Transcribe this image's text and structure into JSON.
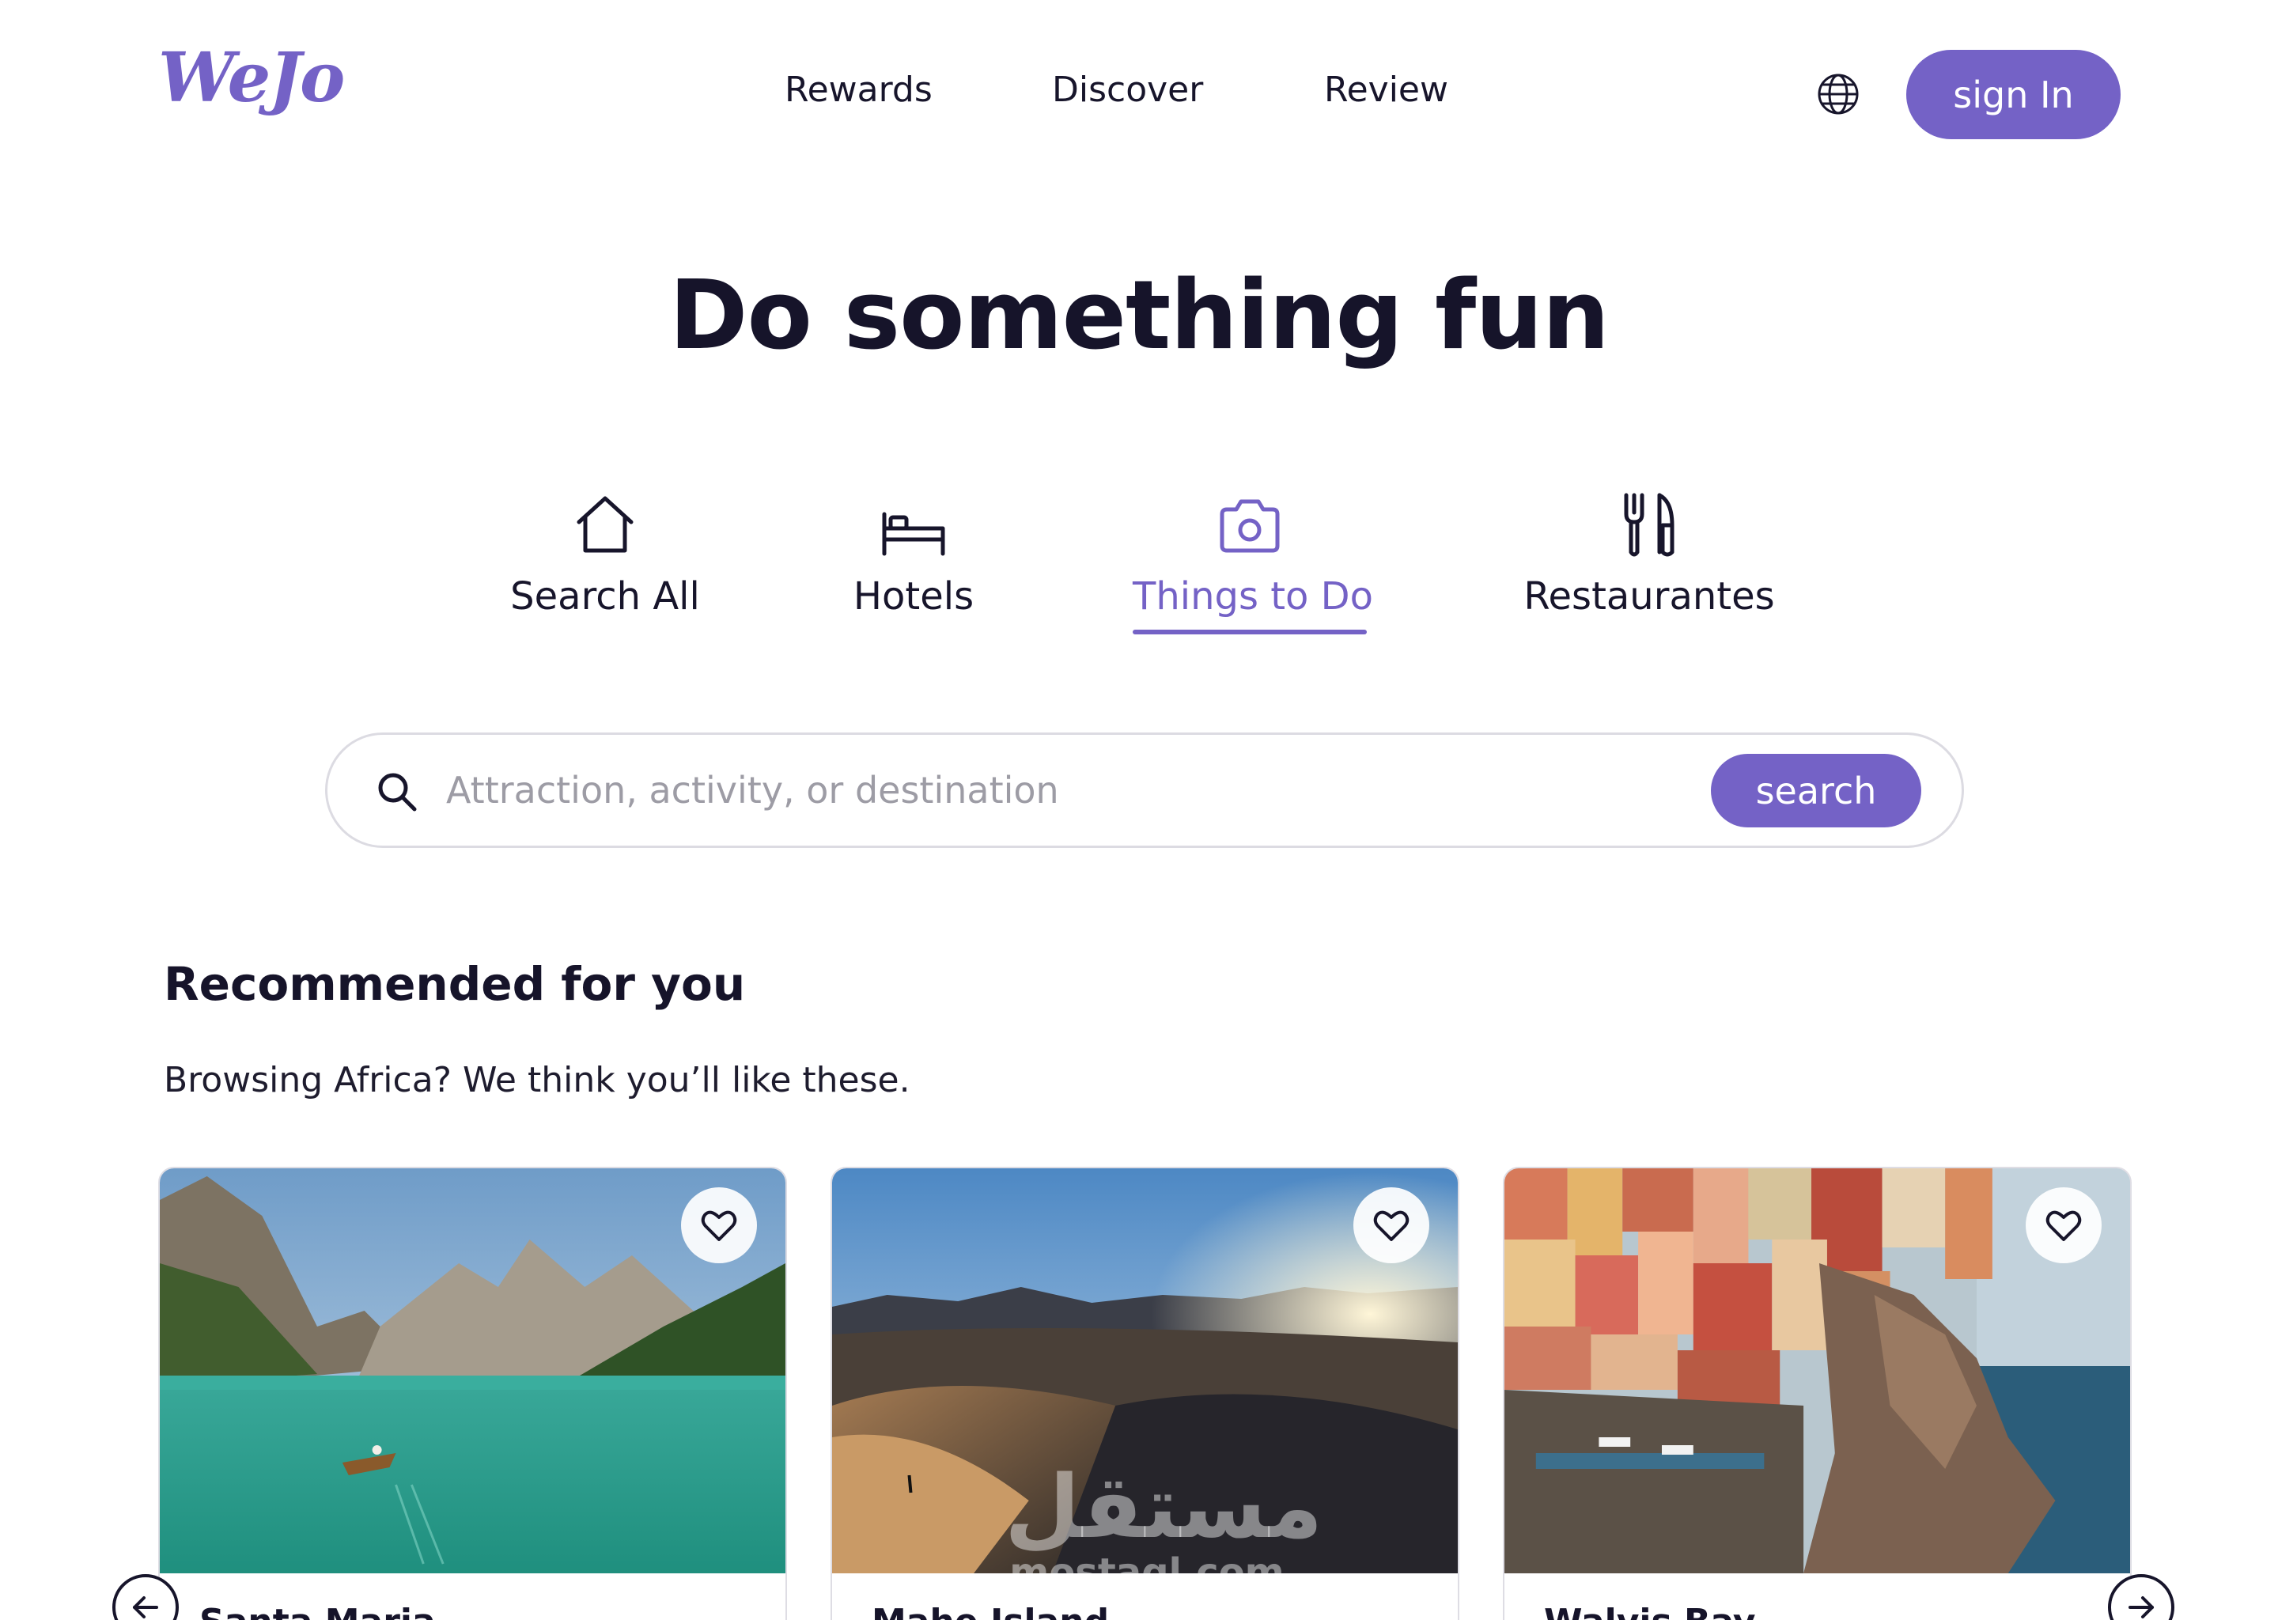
{
  "header": {
    "logo_text": "WeJo",
    "nav": [
      "Rewards",
      "Discover",
      "Review"
    ],
    "signin_label": "sign In",
    "language_icon": "globe-icon"
  },
  "hero": {
    "title": "Do something fun"
  },
  "categories": [
    {
      "label": "Search All",
      "icon": "home-icon",
      "active": false
    },
    {
      "label": "Hotels",
      "icon": "bed-icon",
      "active": false
    },
    {
      "label": "Things to Do",
      "icon": "camera-icon",
      "active": true
    },
    {
      "label": "Restaurantes",
      "icon": "cutlery-icon",
      "active": false
    }
  ],
  "search": {
    "placeholder": "Attraction, activity, or destination",
    "button_label": "search",
    "icon": "search-icon"
  },
  "recommended": {
    "title": "Recommended for you",
    "subtitle": "Browsing Africa? We think you’ll like these.",
    "cards": [
      {
        "name": "Santa Maria",
        "favorite_icon": "heart-icon"
      },
      {
        "name": "Mahe Island",
        "favorite_icon": "heart-icon"
      },
      {
        "name": "Walvis Bay",
        "favorite_icon": "heart-icon"
      }
    ]
  },
  "watermark": {
    "arabic": "مستقل",
    "latin": "mostaql.com"
  },
  "colors": {
    "accent": "#7462c6",
    "text": "#17152b",
    "border": "#dcdbe2"
  }
}
